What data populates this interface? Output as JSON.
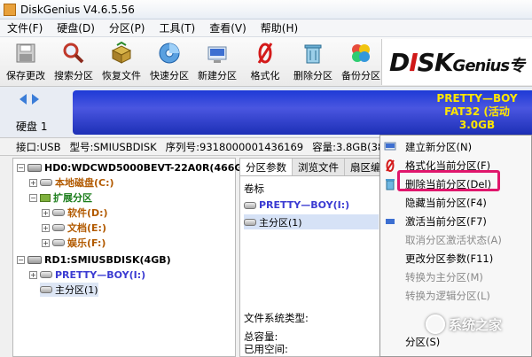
{
  "window": {
    "title": "DiskGenius V4.6.5.56"
  },
  "menu": [
    "文件(F)",
    "硬盘(D)",
    "分区(P)",
    "工具(T)",
    "查看(V)",
    "帮助(H)"
  ],
  "toolbar": [
    {
      "label": "保存更改",
      "icon": "save-icon"
    },
    {
      "label": "搜索分区",
      "icon": "search-icon"
    },
    {
      "label": "恢复文件",
      "icon": "recover-box-icon"
    },
    {
      "label": "快速分区",
      "icon": "quick-partition-disc-icon"
    },
    {
      "label": "新建分区",
      "icon": "new-partition-icon"
    },
    {
      "label": "格式化",
      "icon": "format-icon"
    },
    {
      "label": "删除分区",
      "icon": "delete-partition-icon"
    },
    {
      "label": "备份分区",
      "icon": "backup-partition-icon"
    }
  ],
  "brand": {
    "d": "D",
    "i": "I",
    "s": "S",
    "k": "K",
    "genius": "Genius",
    "suffix": "专"
  },
  "disk_bar": {
    "disk_label": "硬盘 1",
    "partition_name": "PRETTY—BOY",
    "partition_fs": "FAT32 (活动",
    "partition_size": "3.0GB"
  },
  "disk_info": {
    "interface": "接口:USB",
    "model": "型号:SMIUSBDISK",
    "serial": "序列号:9318000001436169",
    "capacity": "容量:3.8GB(3840MB)"
  },
  "tree": {
    "hd0": "HD0:WDCWD5000BEVT-22A0R(466GB)",
    "local_disk": "本地磁盘(C:)",
    "extended": "扩展分区",
    "software": "软件(D:)",
    "documents": "文档(E:)",
    "entertainment": "娱乐(F:)",
    "rd1": "RD1:SMIUSBDISK(4GB)",
    "pretty_boy": "PRETTY—BOY(I:)",
    "primary": "主分区(1)"
  },
  "right_panel": {
    "tabs": [
      "分区参数",
      "浏览文件",
      "扇区编"
    ],
    "volume_header": "卷标",
    "volumes": [
      "PRETTY—BOY(I:)",
      "主分区(1)"
    ],
    "fs_type_label": "文件系统类型:",
    "total_capacity": "总容量:",
    "used_space": "已用空间:"
  },
  "context_menu": [
    {
      "label": "建立新分区(N)",
      "icon": "new-partition-icon",
      "enabled": true
    },
    {
      "label": "格式化当前分区(F)",
      "icon": "format-icon",
      "enabled": true
    },
    {
      "label": "删除当前分区(Del)",
      "icon": "trash-icon",
      "enabled": true
    },
    {
      "label": "隐藏当前分区(F4)",
      "icon": "",
      "enabled": true
    },
    {
      "label": "激活当前分区(F7)",
      "icon": "activate-icon",
      "enabled": true
    },
    {
      "label": "取消分区激活状态(A)",
      "icon": "",
      "enabled": false
    },
    {
      "label": "更改分区参数(F11)",
      "icon": "",
      "enabled": true
    },
    {
      "label": "转换为主分区(M)",
      "icon": "",
      "enabled": false
    },
    {
      "label": "转换为逻辑分区(L)",
      "icon": "",
      "enabled": false
    },
    {
      "label": "分区(S)",
      "icon": "",
      "enabled": true
    }
  ],
  "watermark": "系统之家",
  "colors": {
    "partition_bar": "#1e3ad6",
    "partition_text": "#ffe600",
    "highlight": "#e0166c"
  }
}
